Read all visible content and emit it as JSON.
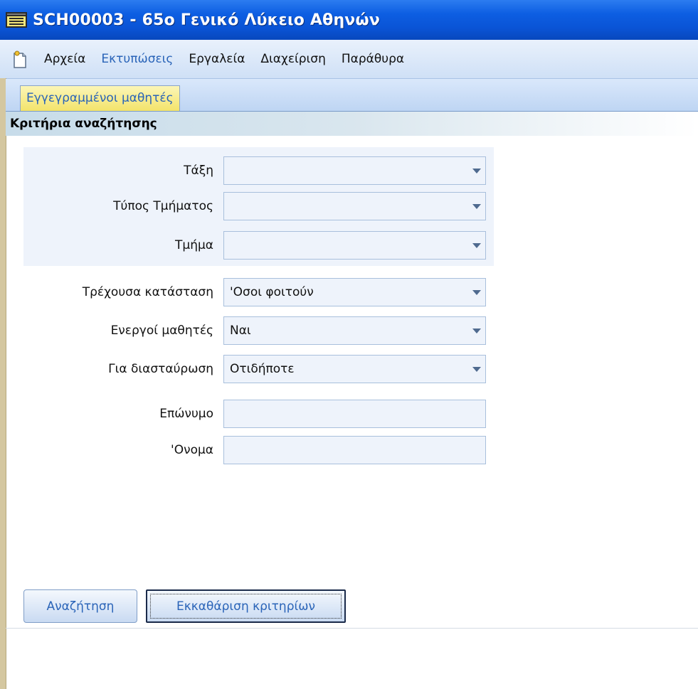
{
  "window": {
    "title": "SCH00003 - 65ο Γενικό Λύκειο Αθηνών"
  },
  "menu": {
    "items": [
      {
        "label": "Αρχεία",
        "active": false
      },
      {
        "label": "Εκτυπώσεις",
        "active": true
      },
      {
        "label": "Εργαλεία",
        "active": false
      },
      {
        "label": "Διαχείριση",
        "active": false
      },
      {
        "label": "Παράθυρα",
        "active": false
      }
    ]
  },
  "tabs": [
    {
      "label": "Εγγεγραμμένοι μαθητές",
      "selected": true
    }
  ],
  "section": {
    "title": "Κριτήρια αναζήτησης"
  },
  "form": {
    "class_label": "Τάξη",
    "class_value": "",
    "section_type_label": "Τύπος Τμήματος",
    "section_type_value": "",
    "section_label": "Τμήμα",
    "section_value": "",
    "status_label": "Τρέχουσα κατάσταση",
    "status_value": "'Οσοι φοιτούν",
    "active_label": "Ενεργοί μαθητές",
    "active_value": "Ναι",
    "cross_check_label": "Για διασταύρωση",
    "cross_check_value": "Οτιδήποτε",
    "surname_label": "Επώνυμο",
    "surname_value": "",
    "name_label": "'Ονομα",
    "name_value": ""
  },
  "buttons": {
    "search": "Αναζήτηση",
    "clear": "Εκκαθάριση κριτηρίων"
  },
  "colors": {
    "titlebar": "#0a54d6",
    "menubar": "#dce8f8",
    "tab": "#f6ea88",
    "field_bg": "#eef3fb",
    "accent_text": "#2a64b8"
  },
  "icons": {
    "title": "notepad-icon",
    "menu": "app-document-icon",
    "dropdown": "chevron-down-icon"
  }
}
